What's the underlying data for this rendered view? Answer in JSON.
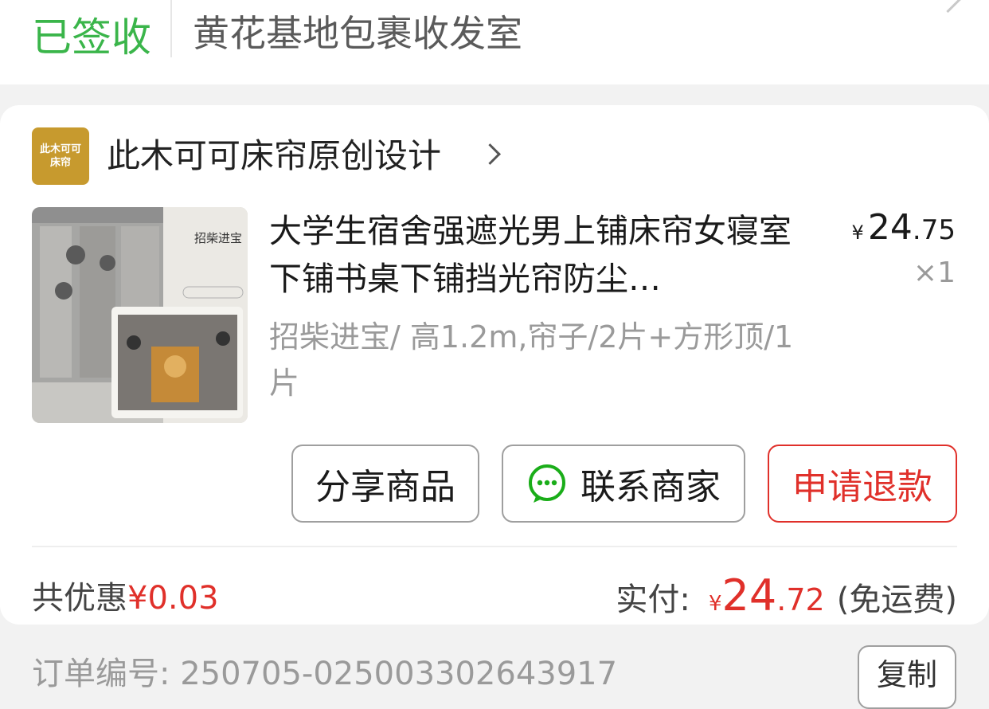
{
  "delivery": {
    "status": "已签收",
    "location": "黄花基地包裹收发室"
  },
  "shop": {
    "logo_line1": "此木可可",
    "logo_line2": "床帘",
    "name": "此木可可床帘原创设计"
  },
  "product": {
    "thumb_text": "招柴进宝",
    "title": "大学生宿舍强遮光男上铺床帘女寝室下铺书桌下铺挡光帘防尘…",
    "sku": "招柴进宝/ 高1.2m,帘子/2片+方形顶/1片",
    "price_currency": "¥",
    "price_int": "24",
    "price_dec": ".75",
    "quantity": "×1"
  },
  "actions": {
    "share": "分享商品",
    "contact": "联系商家",
    "refund": "申请退款"
  },
  "summary": {
    "discount_label": "共优惠",
    "discount_amount": "¥0.03",
    "paid_label": "实付:",
    "paid_currency": "¥",
    "paid_int": "24",
    "paid_dec": ".72",
    "shipping_note": "(免运费)"
  },
  "order": {
    "number_label": "订单编号:",
    "number": "250705-025003302643917",
    "copy": "复制"
  },
  "colors": {
    "signed_green": "#3ab54a",
    "accent_red": "#e0302a",
    "shop_gold": "#c79a2e"
  }
}
